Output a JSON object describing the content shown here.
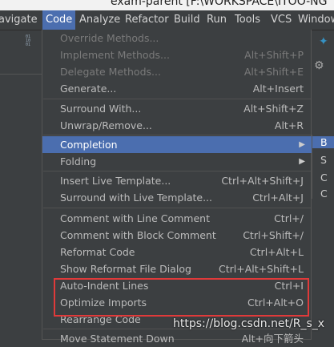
{
  "window": {
    "title": "exam-parent [F:\\WORKSPACE\\ITOO-NG"
  },
  "menubar": {
    "items": [
      "avigate",
      "Code",
      "Analyze",
      "Refactor",
      "Build",
      "Run",
      "Tools",
      "VCS",
      "Window"
    ],
    "active": "Code"
  },
  "menu": {
    "items": [
      {
        "label": "Override Methods...",
        "shortcut": "",
        "disabled": true
      },
      {
        "label": "Implement Methods...",
        "shortcut": "Alt+Shift+P",
        "disabled": true
      },
      {
        "label": "Delegate Methods...",
        "shortcut": "Alt+Shift+E",
        "disabled": true
      },
      {
        "label": "Generate...",
        "shortcut": "Alt+Insert"
      },
      {
        "label": "Surround With...",
        "shortcut": "Alt+Shift+Z"
      },
      {
        "label": "Unwrap/Remove...",
        "shortcut": "Alt+R"
      },
      {
        "label": "Completion",
        "shortcut": ""
      },
      {
        "label": "Folding",
        "shortcut": ""
      },
      {
        "label": "Insert Live Template...",
        "shortcut": "Ctrl+Alt+Shift+J"
      },
      {
        "label": "Surround with Live Template...",
        "shortcut": "Ctrl+Alt+J"
      },
      {
        "label": "Comment with Line Comment",
        "shortcut": "Ctrl+/"
      },
      {
        "label": "Comment with Block Comment",
        "shortcut": "Ctrl+Shift+/"
      },
      {
        "label": "Reformat Code",
        "shortcut": "Ctrl+Alt+L"
      },
      {
        "label": "Show Reformat File Dialog",
        "shortcut": "Ctrl+Alt+Shift+L"
      },
      {
        "label": "Auto-Indent Lines",
        "shortcut": "Ctrl+I"
      },
      {
        "label": "Optimize Imports",
        "shortcut": "Ctrl+Alt+O"
      },
      {
        "label": "Rearrange Code",
        "shortcut": ""
      },
      {
        "label": "Move Statement Down",
        "shortcut": "Alt+向下箭头"
      }
    ]
  },
  "submenu": {
    "items": [
      "B",
      "S",
      "C",
      "C"
    ]
  },
  "watermark": "https://blog.csdn.net/R_s_x",
  "icons": {
    "toolbar": "binary-icon",
    "right_top": "arrow-icon",
    "right_gear": "gear-icon"
  },
  "colors": {
    "selection": "#4b6eaf",
    "highlight_box": "#e03a3a",
    "background": "#3c3f41"
  }
}
